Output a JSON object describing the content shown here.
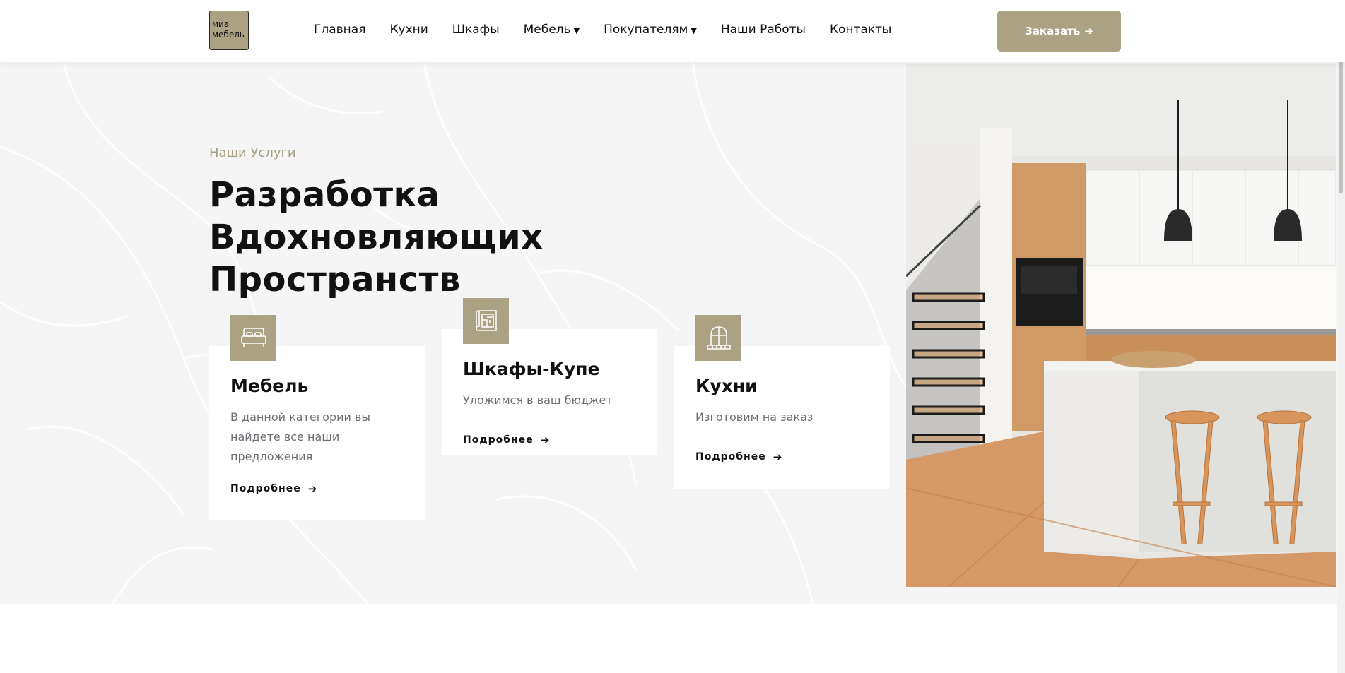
{
  "logo": {
    "line1": "миа",
    "line2": "мебель"
  },
  "nav": {
    "items": [
      {
        "label": "Главная",
        "dropdown": false
      },
      {
        "label": "Кухни",
        "dropdown": false
      },
      {
        "label": "Шкафы",
        "dropdown": false
      },
      {
        "label": "Мебель",
        "dropdown": true
      },
      {
        "label": "Покупателям",
        "dropdown": true
      },
      {
        "label": "Наши Работы",
        "dropdown": false
      },
      {
        "label": "Контакты",
        "dropdown": false
      }
    ],
    "order_label": "Заказать",
    "order_arrow": "➔"
  },
  "hero": {
    "eyebrow": "Наши Услуги",
    "title_line1": "Разработка Вдохновляющих",
    "title_line2": "Пространств"
  },
  "cards": [
    {
      "icon": "bed-icon",
      "title": "Мебель",
      "text": "В данной категории вы найдете все наши предложения",
      "more": "Подробнее",
      "arrow": "➔"
    },
    {
      "icon": "blueprint-icon",
      "title": "Шкафы-Купе",
      "text": "Уложимся в ваш бюджет",
      "more": "Подробнее",
      "arrow": "➔"
    },
    {
      "icon": "window-icon",
      "title": "Кухни",
      "text": "Изготовим на заказ",
      "more": "Подробнее",
      "arrow": "➔"
    }
  ],
  "colors": {
    "accent": "#aba283",
    "hero_bg": "#f5f5f5",
    "text_muted": "#6b6e72"
  }
}
